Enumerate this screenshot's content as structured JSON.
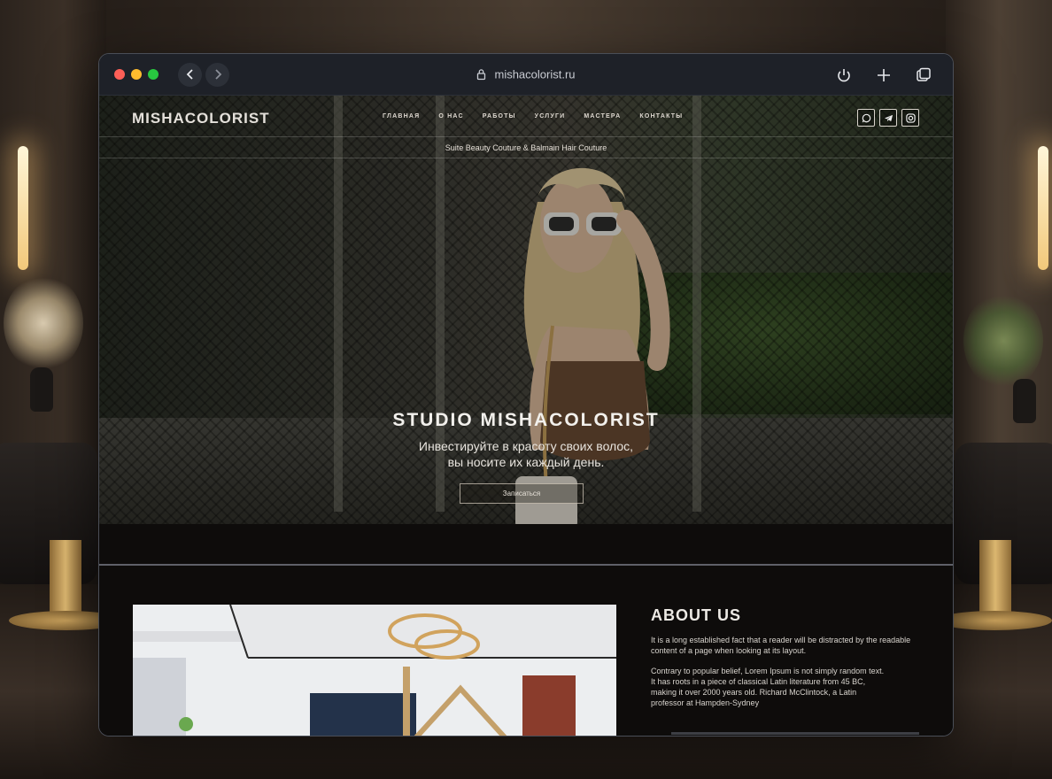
{
  "browser": {
    "url": "mishacolorist.ru"
  },
  "site": {
    "logo": "MISHACOLORIST",
    "nav": [
      "ГЛАВНАЯ",
      "О НАС",
      "РАБОТЫ",
      "УСЛУГИ",
      "МАСТЕРА",
      "КОНТАКТЫ"
    ],
    "tagline": "Suite Beauty Couture & Balmain Hair Couture"
  },
  "hero": {
    "title": "STUDIO MISHACOLORIST",
    "subtitle_line1": "Инвестируйте в красоту своих волос,",
    "subtitle_line2": "вы носите их каждый день.",
    "cta": "Записаться"
  },
  "about": {
    "title": "ABOUT US",
    "p1": "It is a long established fact that a reader will be distracted by the readable content of a page when looking at its layout.",
    "p2": "Contrary to popular belief, Lorem Ipsum is not simply random text. It has roots in a piece of classical Latin literature from 45 BC, making it over 2000 years old. Richard McClintock, a Latin professor at Hampden-Sydney"
  }
}
